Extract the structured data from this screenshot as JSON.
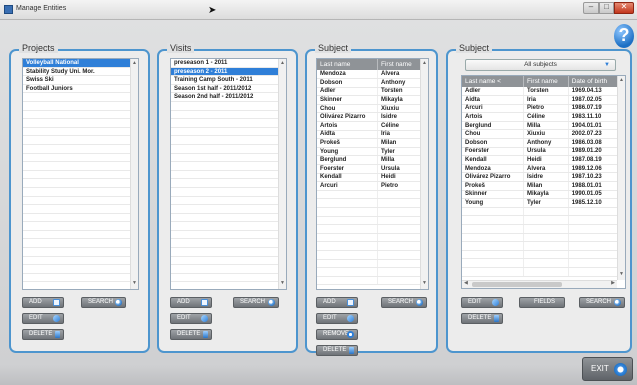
{
  "window": {
    "title": "Manage Entities",
    "minimize": "–",
    "maximize": "□",
    "close": "✕"
  },
  "help_label": "?",
  "projects": {
    "title": "Projects",
    "items": [
      "Volleyball National",
      "Stability Study Uni. Mor.",
      "Swiss Ski",
      "Football Juniors"
    ],
    "selected_index": 0,
    "buttons": {
      "add": "ADD",
      "search": "SEARCH",
      "edit": "EDIT",
      "delete": "DELETE"
    }
  },
  "visits": {
    "title": "Visits",
    "items": [
      "preseason 1 - 2011",
      "preseason 2 - 2011",
      "Training Camp South - 2011",
      "Season 1st half - 2011/2012",
      "Season 2nd half - 2011/2012"
    ],
    "selected_index": 1,
    "buttons": {
      "add": "ADD",
      "search": "SEARCH",
      "edit": "EDIT",
      "delete": "DELETE"
    }
  },
  "subject_mid": {
    "title": "Subject",
    "columns": [
      "Last name",
      "First name"
    ],
    "rows": [
      [
        "Mendoza",
        "Alvera"
      ],
      [
        "Dobson",
        "Anthony"
      ],
      [
        "Adler",
        "Torsten"
      ],
      [
        "Skinner",
        "Mikayla"
      ],
      [
        "Chou",
        "Xiuxiu"
      ],
      [
        "Olivárez Pizarro",
        "Isidre"
      ],
      [
        "Artois",
        "Céline"
      ],
      [
        "Aidta",
        "Iria"
      ],
      [
        "Prokeš",
        "Milan"
      ],
      [
        "Young",
        "Tyler"
      ],
      [
        "Berglund",
        "Milla"
      ],
      [
        "Foerster",
        "Ursula"
      ],
      [
        "Kendall",
        "Heidi"
      ],
      [
        "Arcuri",
        "Pietro"
      ]
    ],
    "buttons": {
      "add": "ADD",
      "search": "SEARCH",
      "edit": "EDIT",
      "remove": "REMOVE",
      "delete": "DELETE"
    }
  },
  "subject_right": {
    "title": "Subject",
    "filter": "All subjects",
    "columns": [
      "Last name <",
      "First name",
      "Date of birth"
    ],
    "rows": [
      [
        "Adler",
        "Torsten",
        "1969.04.13"
      ],
      [
        "Aidta",
        "Iria",
        "1987.02.05"
      ],
      [
        "Arcuri",
        "Pietro",
        "1986.07.19"
      ],
      [
        "Artois",
        "Céline",
        "1983.11.10"
      ],
      [
        "Berglund",
        "Milla",
        "1904.01.01"
      ],
      [
        "Chou",
        "Xiuxiu",
        "2002.07.23"
      ],
      [
        "Dobson",
        "Anthony",
        "1986.03.08"
      ],
      [
        "Foerster",
        "Ursula",
        "1989.01.20"
      ],
      [
        "Kendall",
        "Heidi",
        "1987.08.19"
      ],
      [
        "Mendoza",
        "Alvera",
        "1989.12.06"
      ],
      [
        "Olivárez Pizarro",
        "Isidre",
        "1987.10.23"
      ],
      [
        "Prokeš",
        "Milan",
        "1988.01.01"
      ],
      [
        "Skinner",
        "Mikayla",
        "1990.01.05"
      ],
      [
        "Young",
        "Tyler",
        "1985.12.10"
      ]
    ],
    "buttons": {
      "edit": "EDIT",
      "fields": "FIELDS",
      "search": "SEARCH",
      "delete": "DELETE"
    }
  },
  "exit_label": "EXIT"
}
